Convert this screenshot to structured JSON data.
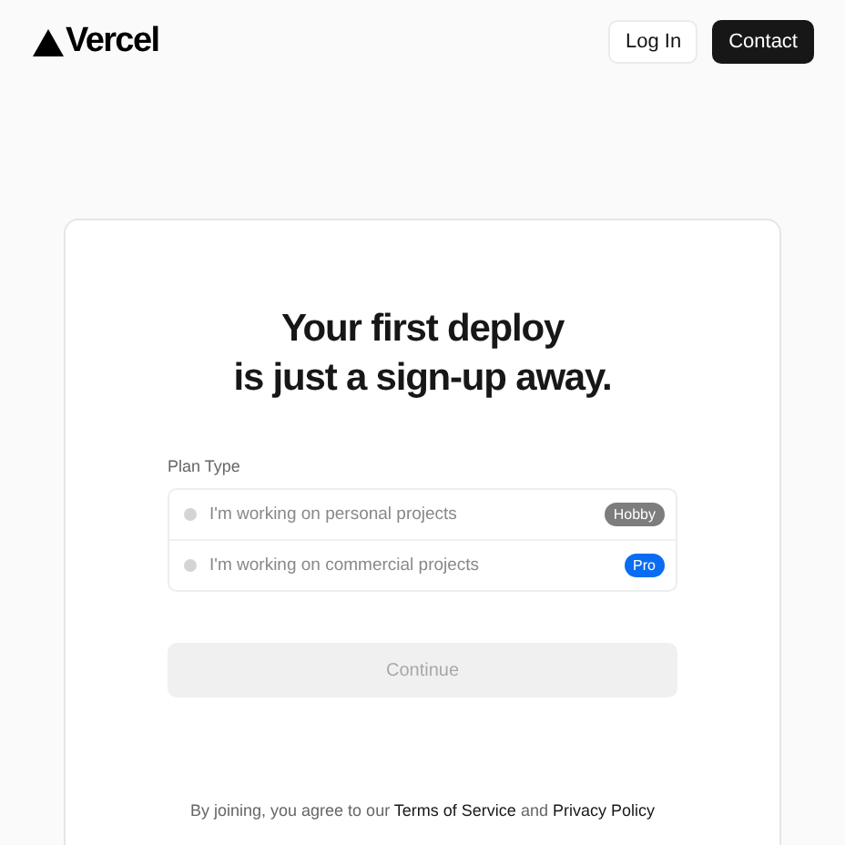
{
  "header": {
    "logo": "Vercel",
    "buttons": [
      {
        "label": "Log In",
        "kind": "secondary"
      },
      {
        "label": "Contact",
        "kind": "primary"
      }
    ]
  },
  "card": {
    "title_lines": [
      "Your first deploy",
      "is just a sign-up away."
    ],
    "plan_type": {
      "label": "Plan Type",
      "options": [
        {
          "label": "I'm working on personal projects",
          "badge": "Hobby",
          "color": "#7d7d7d",
          "selected": false
        },
        {
          "label": "I'm working on commercial projects",
          "badge": "Pro",
          "color": "#0a6cf0",
          "selected": false
        }
      ]
    },
    "continue": {
      "label": "Continue",
      "disabled": true
    },
    "legal": {
      "prefix": "By joining, you agree to our",
      "terms": "Terms of Service",
      "middle": "and",
      "privacy": "Privacy Policy"
    }
  }
}
